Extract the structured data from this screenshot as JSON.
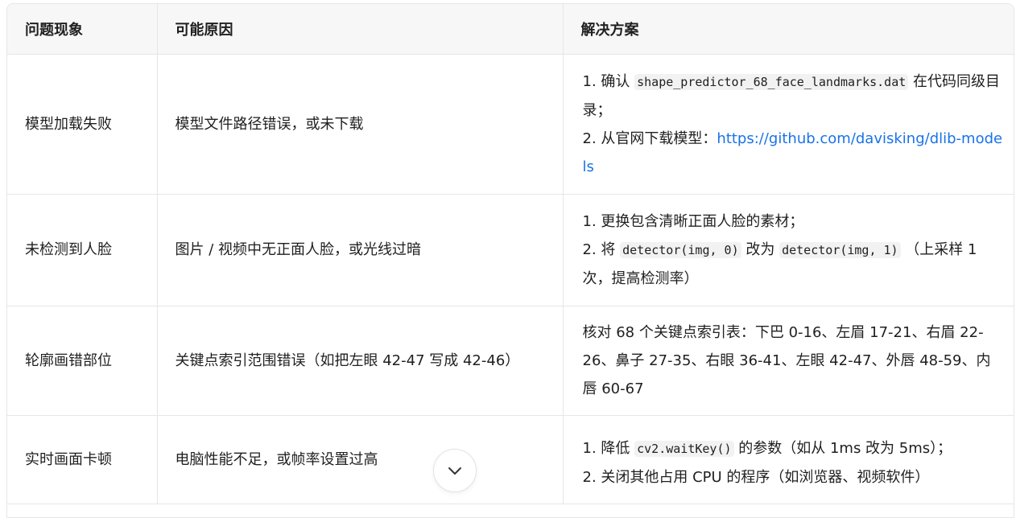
{
  "header": {
    "col1": "问题现象",
    "col2": "可能原因",
    "col3": "解决方案"
  },
  "rows": [
    {
      "symptom": "模型加载失败",
      "cause": "模型文件路径错误，或未下载",
      "sol": {
        "l1_pre": "1. 确认 ",
        "l1_code": "shape_predictor_68_face_landmarks.dat",
        "l1_post": " 在代码同级目录；",
        "l2_pre": "2. 从官网下载模型：",
        "l2_link": "https://github.com/davisking/dlib-models"
      }
    },
    {
      "symptom": "未检测到人脸",
      "cause": "图片 / 视频中无正面人脸，或光线过暗",
      "sol": {
        "l1": "1. 更换包含清晰正面人脸的素材；",
        "l2_pre": "2. 将 ",
        "l2_code1": "detector(img, 0)",
        "l2_mid": " 改为 ",
        "l2_code2": "detector(img, 1)",
        "l2_post": " （上采样 1 次，提高检测率）"
      }
    },
    {
      "symptom": "轮廓画错部位",
      "cause": "关键点索引范围错误（如把左眼 42-47 写成 42-46）",
      "sol": {
        "text": "核对 68 个关键点索引表：下巴 0-16、左眉 17-21、右眉 22-26、鼻子 27-35、右眼 36-41、左眼 42-47、外唇 48-59、内唇 60-67"
      }
    },
    {
      "symptom": "实时画面卡顿",
      "cause": "电脑性能不足，或帧率设置过高",
      "sol": {
        "l1_pre": "1. 降低 ",
        "l1_code": "cv2.waitKey()",
        "l1_post": " 的参数（如从 1ms 改为 5ms）；",
        "l2": "2. 关闭其他占用 CPU 的程序（如浏览器、视频软件）"
      }
    }
  ],
  "colors": {
    "link": "#1a73e8",
    "header_bg": "#f7f7f7",
    "border": "#e6e6e6"
  },
  "icons": {
    "scroll_down": "chevron-down-icon"
  }
}
